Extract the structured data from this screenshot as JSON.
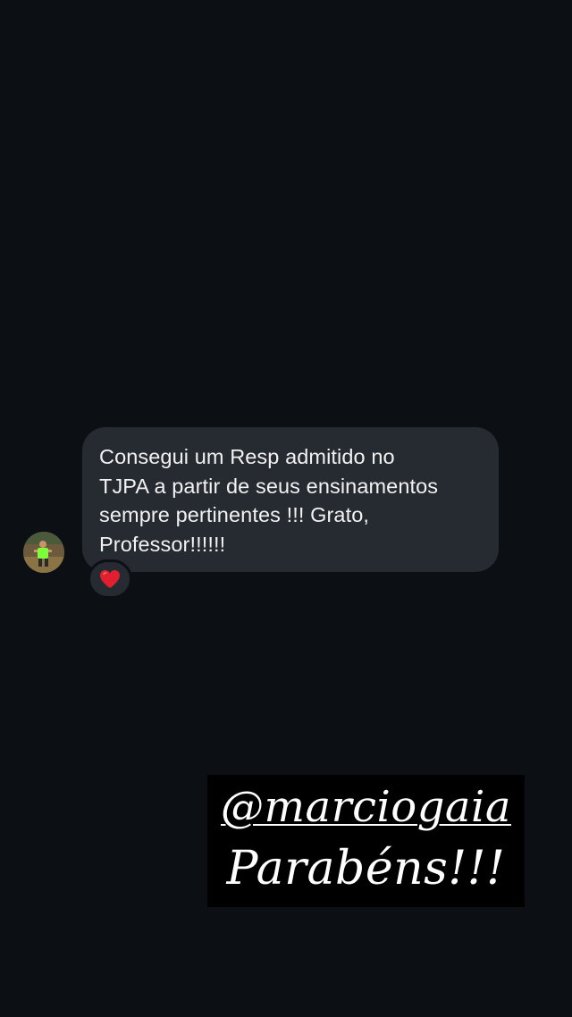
{
  "message": {
    "text": "Consegui um Resp admitido no TJPA a partir de seus ensinamentos sempre pertinentes !!! Grato, Professor!!!!!!",
    "lines": [
      "Consegui um Resp admitido no",
      "TJPA a partir de seus ensinamentos",
      "sempre pertinentes !!! Grato,",
      "Professor!!!!!!"
    ],
    "reaction": "❤️"
  },
  "caption": {
    "handle": "@marciogaia",
    "text": "Parabéns!!!"
  },
  "colors": {
    "background": "#0c1015",
    "bubble": "#262a31",
    "bubble_text": "#f2f2f2",
    "caption_bg": "#000000",
    "caption_text": "#ffffff",
    "heart": "#e0202e"
  },
  "icons": {
    "avatar": "profile-photo-runner",
    "reaction": "red-heart-icon"
  }
}
